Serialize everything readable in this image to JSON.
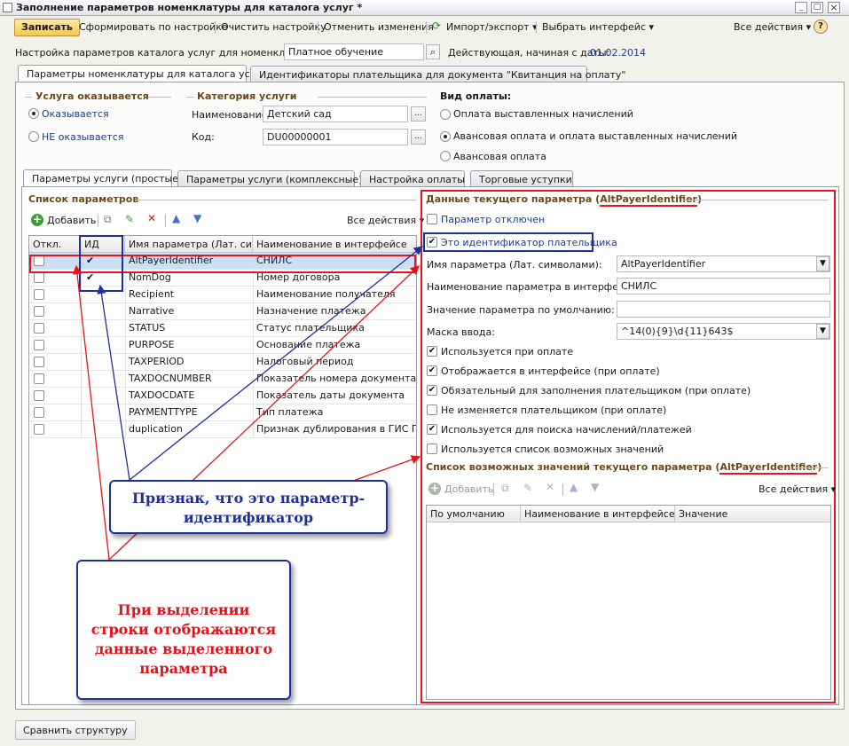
{
  "window": {
    "title": "Заполнение параметров номенклатуры для каталога услуг *"
  },
  "toolbar": {
    "save": "Записать",
    "build": "Сформировать по настройке",
    "clear": "Очистить настройку",
    "cancel": "Отменить изменения",
    "import": "Импорт/экспорт",
    "choose": "Выбрать интерфейс",
    "all_actions": "Все действия",
    "help": "?"
  },
  "settings": {
    "label": "Настройка параметров каталога услуг для номенклатуры:",
    "value": "Платное обучение",
    "date_label": "Действующая, начиная с даты:",
    "date": "01.02.2014"
  },
  "outer_tabs": [
    "Параметры номенклатуры для каталога услуг",
    "Идентификаторы плательщика для документа \"Квитанция на оплату\""
  ],
  "service": {
    "title": "Услуга оказывается",
    "opt1": "Оказывается",
    "opt2": "НЕ оказывается"
  },
  "category": {
    "title": "Категория услуги",
    "name_label": "Наименование:",
    "name_value": "Детский сад",
    "code_label": "Код:",
    "code_value": "DU00000001",
    "dots": "..."
  },
  "payment": {
    "title": "Вид оплаты:",
    "opt1": "Оплата выставленных начислений",
    "opt2": "Авансовая оплата и оплата выставленных начислений",
    "opt3": "Авансовая оплата"
  },
  "inner_tabs": [
    "Параметры услуги (простые)",
    "Параметры услуги (комплексные)",
    "Настройка оплаты",
    "Торговые уступки"
  ],
  "params": {
    "title": "Список параметров",
    "add": "Добавить",
    "all_actions": "Все действия",
    "columns": [
      "Откл.",
      "ИД",
      "Имя параметра (Лат. си...",
      "Наименование в интерфейсе"
    ],
    "rows": [
      {
        "name": "AltPayerIdentifier",
        "title": "СНИЛС",
        "id": "✔"
      },
      {
        "name": "NomDog",
        "title": "Номер договора",
        "id": "✔"
      },
      {
        "name": "Recipient",
        "title": "Наименование получателя",
        "id": ""
      },
      {
        "name": "Narrative",
        "title": "Назначение платежа",
        "id": ""
      },
      {
        "name": "STATUS",
        "title": "Статус плательщика",
        "id": ""
      },
      {
        "name": "PURPOSE",
        "title": "Основание платежа",
        "id": ""
      },
      {
        "name": "TAXPERIOD",
        "title": "Налоговый период",
        "id": ""
      },
      {
        "name": "TAXDOCNUMBER",
        "title": "Показатель номера документа",
        "id": ""
      },
      {
        "name": "TAXDOCDATE",
        "title": "Показатель даты документа",
        "id": ""
      },
      {
        "name": "PAYMENTTYPE",
        "title": "Тип платежа",
        "id": ""
      },
      {
        "name": "duplication",
        "title": "Признак дублирования в ГИС ГМП",
        "id": ""
      }
    ]
  },
  "current": {
    "title_prefix": "Данные текущего параметра (",
    "title_name": "AltPayerIdentifier",
    "title_suffix": ")",
    "disabled": "Параметр отключен",
    "is_id": "Это идентификатор плательщика",
    "name_label": "Имя параметра (Лат. символами):",
    "name_value": "AltPayerIdentifier",
    "title_label": "Наименование параметра в интерфейсе:",
    "title_value": "СНИЛС",
    "default_label": "Значение параметра по умолчанию:",
    "default_value": "",
    "mask_label": "Маска ввода:",
    "mask_value": "^14(0){9}\\d{11}643$",
    "checks": [
      {
        "label": "Используется при оплате",
        "checked": true
      },
      {
        "label": "Отображается в интерфейсе (при оплате)",
        "checked": true
      },
      {
        "label": "Обязательный для заполнения плательщиком (при оплате)",
        "checked": true
      },
      {
        "label": "Не изменяется плательщиком (при оплате)",
        "checked": false
      },
      {
        "label": "Используется для поиска начислений/платежей",
        "checked": true
      },
      {
        "label": "Используется список возможных значений",
        "checked": false
      }
    ]
  },
  "values_list": {
    "title_prefix": "Список возможных значений текущего параметра (",
    "title_name": "AltPayerIdentifier",
    "title_suffix": ")",
    "add": "Добавить",
    "all_actions": "Все действия",
    "columns": [
      "По умолчанию",
      "Наименование в интерфейсе",
      "Значение"
    ]
  },
  "callouts": {
    "id_flag": "Признак, что это параметр-идентификатор",
    "row_select": "При выделении строки отображаются данные выделенного параметра"
  },
  "footer": {
    "compare": "Сравнить структуру"
  },
  "colors": {
    "highlight_red": "#e8141b",
    "highlight_blue": "#1e2fa0",
    "callout_red_text": "#e0131b",
    "callout_blue_text": "#1e2fa0"
  }
}
